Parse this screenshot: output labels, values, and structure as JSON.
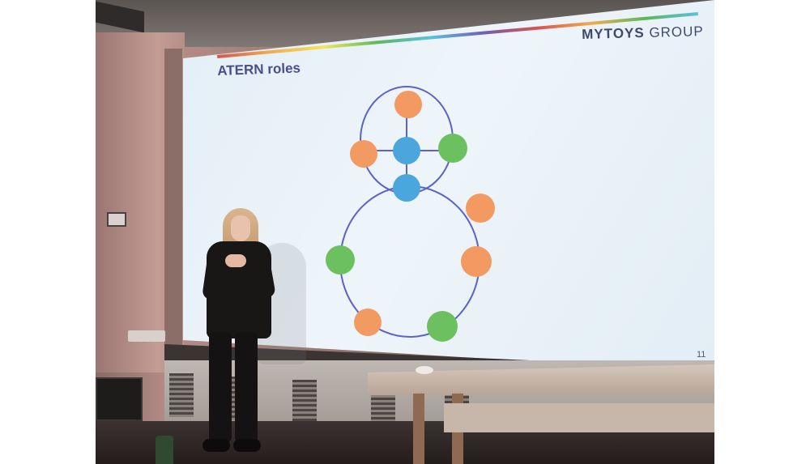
{
  "slide": {
    "title": "ATERN roles",
    "brand_strong": "MYTOYS",
    "brand_rest": " GROUP",
    "page_number": "11"
  },
  "colors": {
    "title": "#4a4f8c",
    "orange_node": "#f39a62",
    "blue_node": "#4aa6dc",
    "green_node": "#6cc060",
    "loop_line": "#5b62c9"
  },
  "diagram": {
    "nodes": [
      {
        "id": "top",
        "color": "orange"
      },
      {
        "id": "upper-left",
        "color": "orange"
      },
      {
        "id": "center",
        "color": "blue"
      },
      {
        "id": "upper-right",
        "color": "green"
      },
      {
        "id": "middle",
        "color": "blue"
      },
      {
        "id": "right-1",
        "color": "orange"
      },
      {
        "id": "left-1",
        "color": "green"
      },
      {
        "id": "right-2",
        "color": "orange"
      },
      {
        "id": "bottom-left",
        "color": "orange"
      },
      {
        "id": "bottom-right",
        "color": "green"
      }
    ]
  }
}
